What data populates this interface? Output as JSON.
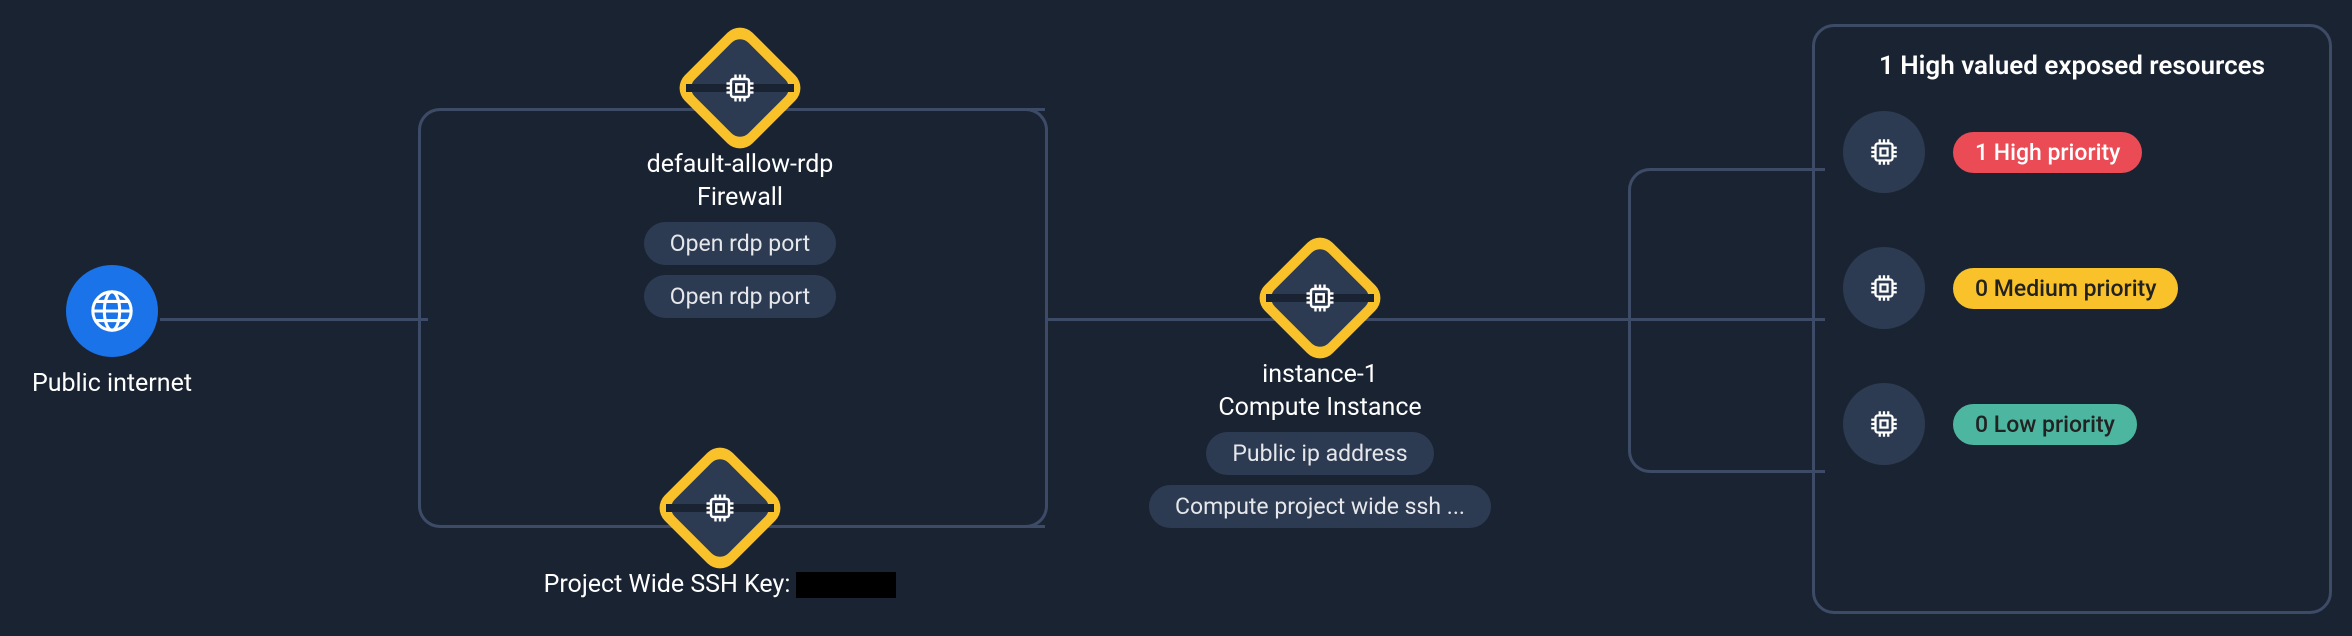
{
  "nodes": {
    "internet": {
      "label": "Public internet"
    },
    "firewall": {
      "title": "default-allow-rdp",
      "subtitle": "Firewall",
      "tags": [
        "Open rdp port",
        "Open rdp port"
      ]
    },
    "sshkey": {
      "title_prefix": "Project Wide SSH Key:"
    },
    "instance": {
      "title": "instance-1",
      "subtitle": "Compute Instance",
      "tags": [
        "Public ip address",
        "Compute project wide ssh ..."
      ]
    }
  },
  "panel": {
    "title": "1 High valued exposed resources",
    "rows": [
      {
        "label": "1 High priority",
        "severity": "high"
      },
      {
        "label": "0 Medium priority",
        "severity": "med"
      },
      {
        "label": "0 Low priority",
        "severity": "low"
      }
    ]
  }
}
